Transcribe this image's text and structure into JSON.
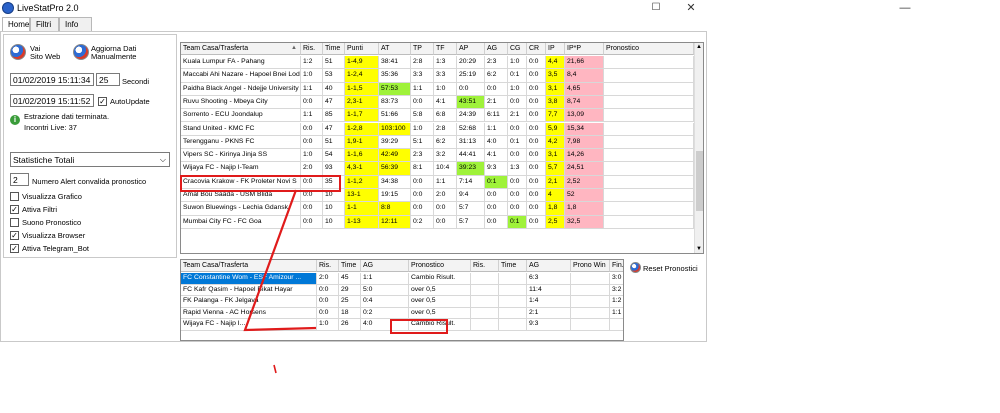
{
  "window": {
    "title": "LiveStatPro 2.0",
    "minimize": "—",
    "maximize": "☐",
    "close": "✕"
  },
  "tabs": [
    "Home",
    "Filtri",
    "Info"
  ],
  "left": {
    "site_label": "Vai\nSito Web",
    "update_label": "Aggiorna Dati\nManualmente",
    "datetime1": "01/02/2019 15:11:34",
    "seconds_value": "25",
    "seconds_label": "Secondi",
    "datetime2": "01/02/2019 15:11:52",
    "autoupdate_label": "AutoUpdate",
    "status_line1": "Estrazione dati terminata.",
    "status_line2": "Incontri Live: 37",
    "stats_select": "Statistiche Totali",
    "alert_value": "2",
    "alert_label": "Numero Alert convalida pronostico",
    "checkboxes": [
      {
        "label": "Visualizza Grafico",
        "checked": false
      },
      {
        "label": "Attiva Filtri",
        "checked": true
      },
      {
        "label": "Suono Pronostico",
        "checked": false
      },
      {
        "label": "Visualizza Browser",
        "checked": true
      },
      {
        "label": "Attiva Telegram_Bot",
        "checked": true
      }
    ]
  },
  "top_table": {
    "headers": [
      "Team Casa/Trasferta",
      "Ris.",
      "Time",
      "Punti",
      "AT",
      "TP",
      "TF",
      "AP",
      "AG",
      "CG",
      "CR",
      "IP",
      "IP*P",
      "Pronostico"
    ],
    "rows": [
      [
        "Kuala Lumpur FA - Pahang",
        "1:2",
        "51",
        "1-4,9",
        "38:41",
        "2:8",
        "1:3",
        "20:29",
        "2:3",
        "1:0",
        "0:0",
        "4,4",
        "21,66",
        ""
      ],
      [
        "Maccabi Ahi Nazare - Hapoel Bnei Lod",
        "1:0",
        "53",
        "1-2,4",
        "35:36",
        "3:3",
        "3:3",
        "25:19",
        "6:2",
        "0:1",
        "0:0",
        "3,5",
        "8,4",
        ""
      ],
      [
        "Paidha Black Angel - Ndejje University",
        "1:1",
        "40",
        "1-1,5",
        "57:53",
        "1:1",
        "1:0",
        "0:0",
        "0:0",
        "1:0",
        "0:0",
        "3,1",
        "4,65",
        ""
      ],
      [
        "Ruvu Shooting - Mbeya City",
        "0:0",
        "47",
        "2,3-1",
        "83:73",
        "0:0",
        "4:1",
        "43:51",
        "2:1",
        "0:0",
        "0:0",
        "3,8",
        "8,74",
        ""
      ],
      [
        "Sorrento - ECU Joondalup",
        "1:1",
        "85",
        "1-1,7",
        "51:66",
        "5:8",
        "6:8",
        "24:39",
        "6:11",
        "2:1",
        "0:0",
        "7,7",
        "13,09",
        ""
      ],
      [
        "Stand United - KMC FC",
        "0:0",
        "47",
        "1-2,8",
        "103:100",
        "1:0",
        "2:8",
        "52:68",
        "1:1",
        "0:0",
        "0:0",
        "5,9",
        "15,34",
        ""
      ],
      [
        "Terengganu - PKNS FC",
        "0:0",
        "51",
        "1,9-1",
        "39:29",
        "5:1",
        "6:2",
        "31:13",
        "4:0",
        "0:1",
        "0:0",
        "4,2",
        "7,98",
        ""
      ],
      [
        "Vipers SC - Kirinya Jinja SS",
        "1:0",
        "54",
        "1-1,6",
        "42:49",
        "2:3",
        "3:2",
        "44:41",
        "4:1",
        "0:0",
        "0:0",
        "3,1",
        "14,26",
        ""
      ],
      [
        "Wijaya FC - Najip I-Team",
        "2:0",
        "93",
        "4,3-1",
        "56:39",
        "8:1",
        "10:4",
        "39:23",
        "9:3",
        "1:3",
        "0:0",
        "5,7",
        "24,51",
        ""
      ],
      [
        "Cracovia Krakow - FK Proleter Novi S",
        "0:0",
        "35",
        "1-1,2",
        "34:38",
        "0:0",
        "1:1",
        "7:14",
        "0:1",
        "0:0",
        "0:0",
        "2,1",
        "2,52",
        ""
      ],
      [
        "Amal Bou Saâda - USM Blida",
        "0:0",
        "10",
        "13-1",
        "19:15",
        "0:0",
        "2:0",
        "9:4",
        "0:0",
        "0:0",
        "0:0",
        "4",
        "52",
        ""
      ],
      [
        "Suwon Bluewings - Lechia Gdansk",
        "0:0",
        "10",
        "1-1",
        "8:8",
        "0:0",
        "0:0",
        "5:7",
        "0:0",
        "0:0",
        "0:0",
        "1,8",
        "1,8",
        ""
      ],
      [
        "Mumbai City FC - FC Goa",
        "0:0",
        "10",
        "1-13",
        "12:11",
        "0:2",
        "0:0",
        "5:7",
        "0:0",
        "0:1",
        "0:0",
        "2,5",
        "32,5",
        ""
      ]
    ]
  },
  "bottom_table": {
    "headers": [
      "Team Casa/Trasferta",
      "Ris.",
      "Time",
      "AG",
      "Pronostico",
      "Ris.",
      "Time",
      "AG",
      "Prono Win",
      "Fin."
    ],
    "rows": [
      [
        "FC Constantine Wom - ESF Amizour ...",
        "2:0",
        "45",
        "1:1",
        "Cambio Risult.",
        "",
        "",
        "6:3",
        "",
        "3:0"
      ],
      [
        "FC Kafr Qasim - Hapoel Bikat Hayar",
        "0:0",
        "29",
        "5:0",
        "over 0,5",
        "",
        "",
        "11:4",
        "",
        "3:2"
      ],
      [
        "FK Palanga - FK Jelgava",
        "0:0",
        "25",
        "0:4",
        "over 0,5",
        "",
        "",
        "1:4",
        "",
        "1:2"
      ],
      [
        "Rapid Vienna - AC Horsens",
        "0:0",
        "18",
        "0:2",
        "over 0,5",
        "",
        "",
        "2:1",
        "",
        "1:1"
      ],
      [
        "Wijaya FC - Najip I...",
        "1:0",
        "26",
        "4:0",
        "Cambio Risult.",
        "",
        "",
        "9:3",
        "",
        ""
      ]
    ]
  },
  "reset_label": "Reset Pronostici",
  "colors": {
    "yellow": "#ffff00",
    "green": "#9ff23a",
    "pink": "#ffb6c1",
    "selection": "#0078d7",
    "annotation": "#e01b1b"
  }
}
